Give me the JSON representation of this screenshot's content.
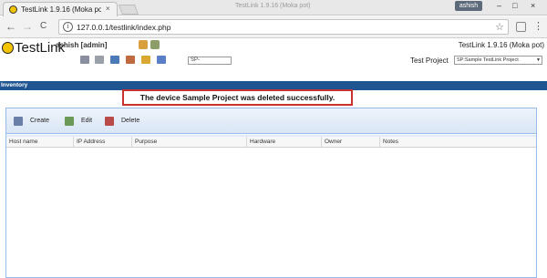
{
  "browser": {
    "tab_title": "TestLink 1.9.16 (Moka po",
    "tab_close": "×",
    "window_title": "TestLink 1.9.16 (Moka pot)",
    "user": "ashish",
    "url": "127.0.0.1/testlink/index.php",
    "info_glyph": "i",
    "back_glyph": "←",
    "forward_glyph": "→",
    "reload_glyph": "C",
    "star_glyph": "☆",
    "menu_glyph": "⋮",
    "minimize_glyph": "–",
    "maximize_glyph": "□",
    "close_glyph": "×"
  },
  "header": {
    "logo_text": "TestLink",
    "user_label": "ashish [admin]",
    "version": "TestLink 1.9.16 (Moka pot)",
    "testcase_prefix": "SP-",
    "test_project_label": "Test Project",
    "test_project_value": "SP:Sample TestLink Project"
  },
  "inventory_bar": {
    "title": "Inventory"
  },
  "message": "The device Sample Project was deleted successfully.",
  "toolbar": {
    "create_label": "Create",
    "edit_label": "Edit",
    "delete_label": "Delete"
  },
  "columns": [
    "Host name",
    "IP Address",
    "Purpose",
    "Hardware",
    "Owner",
    "Notes"
  ],
  "colors": {
    "accent_bar": "#1f5590",
    "message_border": "#c8332e",
    "panel_border": "#99bbe8"
  }
}
